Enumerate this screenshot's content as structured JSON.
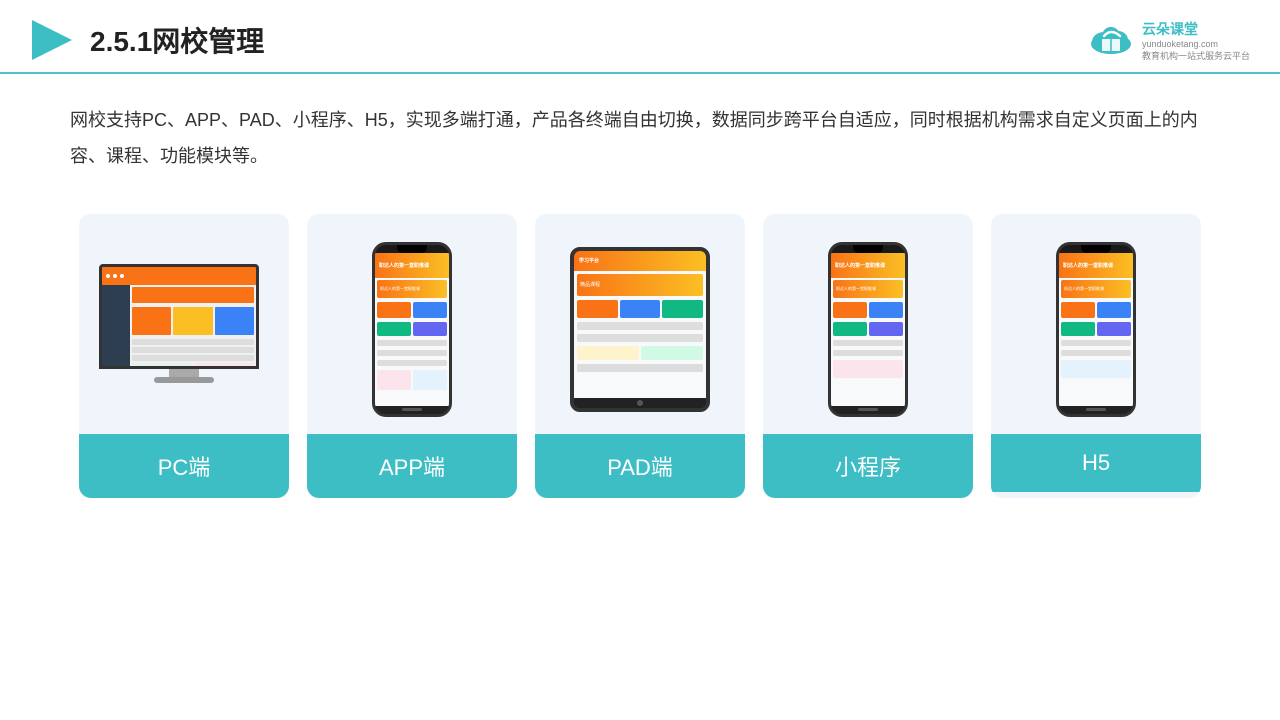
{
  "header": {
    "title": "2.5.1网校管理",
    "logo_name": "云朵课堂",
    "logo_domain": "yunduoketang.com",
    "logo_tagline": "教育机构一站式服务云平台"
  },
  "description": {
    "text": "网校支持PC、APP、PAD、小程序、H5，实现多端打通，产品各终端自由切换，数据同步跨平台自适应，同时根据机构需求自定义页面上的内容、课程、功能模块等。"
  },
  "cards": [
    {
      "id": "pc",
      "label": "PC端"
    },
    {
      "id": "app",
      "label": "APP端"
    },
    {
      "id": "pad",
      "label": "PAD端"
    },
    {
      "id": "miniprogram",
      "label": "小程序"
    },
    {
      "id": "h5",
      "label": "H5"
    }
  ],
  "colors": {
    "accent": "#3dbec4",
    "header_line": "#4FC3C8",
    "card_bg": "#f0f4fb",
    "label_bg": "#3dbec4"
  }
}
